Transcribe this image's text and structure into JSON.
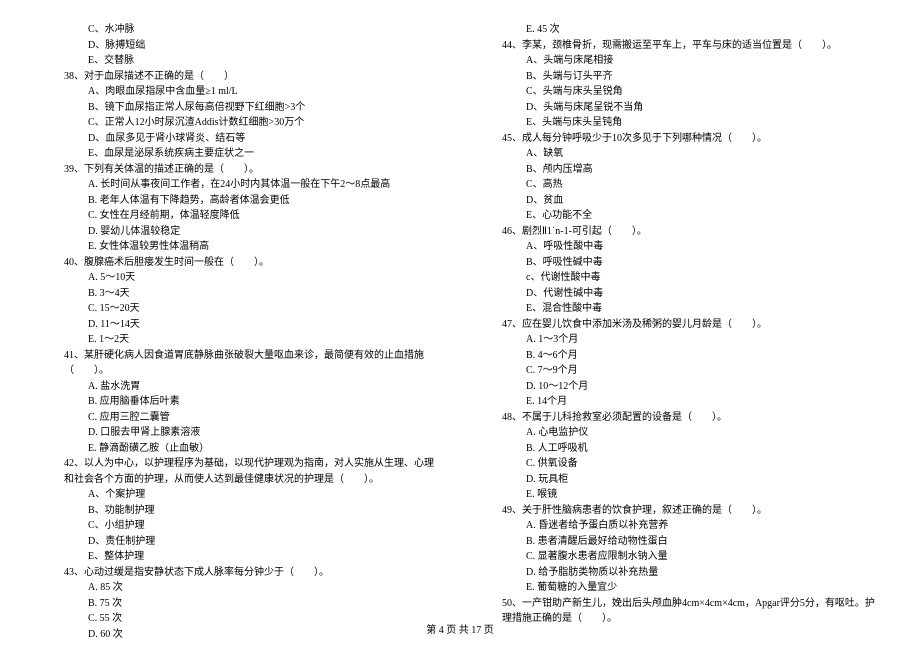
{
  "left": {
    "opts_pre38": [
      "C、水冲脉",
      "D、脉搏短绌",
      "E、交替脉"
    ],
    "q38": "38、对于血尿描述不正确的是（　　）",
    "q38_opts": [
      "A、肉眼血尿指尿中含血量≥1 ml/L",
      "B、镜下血尿指正常人尿每高倍视野下红细胞>3个",
      "C、正常人12小时尿沉渣Addis计数红细胞>30万个",
      "D、血尿多见于肾小球肾炎、结石等",
      "E、血尿是泌尿系统疾病主要症状之一"
    ],
    "q39": "39、下列有关体温的描述正确的是（　　）。",
    "q39_opts": [
      "A. 长时间从事夜间工作者，在24小时内其体温一般在下午2～8点最高",
      "B. 老年人体温有下降趋势，高龄者体温会更低",
      "C. 女性在月经前期，体温轻度降低",
      "D. 婴幼儿体温较稳定",
      "E. 女性体温较男性体温稍高"
    ],
    "q40": "40、腹腺癌术后胆瘘发生时间一般在（　　）。",
    "q40_opts": [
      "A. 5～10天",
      "B. 3～4天",
      "C. 15～20天",
      "D. 11～14天",
      "E. 1～2天"
    ],
    "q41": "41、某肝硬化病人因食道胃底静脉曲张破裂大量呕血来诊，最简便有效的止血措施（　　）。",
    "q41_opts": [
      "A. 盐水洗胃",
      "B. 应用脑垂体后叶素",
      "C. 应用三腔二囊管",
      "D. 口服去甲肾上腺素溶液",
      "E. 静滴酚磺乙胺（止血敏）"
    ],
    "q42": "42、以人为中心，以护理程序为基础，以现代护理观为指南，对人实施从生理、心理和社会各个方面的护理，从而使人达到最佳健康状况的护理是（　　）。",
    "q42_opts": [
      "A、个案护理",
      "B、功能制护理",
      "C、小组护理",
      "D、责任制护理",
      "E、整体护理"
    ],
    "q43": "43、心动过缓是指安静状态下成人脉率每分钟少于（　　）。",
    "q43_opts": [
      "A.  85 次",
      "B.  75 次",
      "C.  55 次",
      "D.  60 次"
    ]
  },
  "right": {
    "opts_pre44": [
      "E.  45 次"
    ],
    "q44": "44、李某，颈椎骨折，现需搬运至平车上，平车与床的适当位置是（　　）。",
    "q44_opts": [
      "A、头端与床尾相接",
      "B、头端与订头平齐",
      "C、头端与床头呈锐角",
      "D、头端与床尾呈锐不当角",
      "E、头端与床头呈钝角"
    ],
    "q45": "45、成人每分钟呼吸少于10次多见于下列哪种情况（　　）。",
    "q45_opts": [
      "A、缺氧",
      "B、颅内压增高",
      "C、高热",
      "D、贫血",
      "E、心功能不全"
    ],
    "q46": "46、剧烈Ⅱ1˙n-1-可引起（　　）。",
    "q46_opts": [
      "A、呼吸性酸中毒",
      "B、呼吸性碱中毒",
      "c、代谢性酸中毒",
      "D、代谢性碱中毒",
      "E、混合性酸中毒"
    ],
    "q47": "47、应在婴儿饮食中添加米汤及稀粥的婴儿月龄是（　　）。",
    "q47_opts": [
      "A. 1～3个月",
      "B. 4～6个月",
      "C. 7～9个月",
      "D. 10～12个月",
      "E. 14个月"
    ],
    "q48": "48、不属于儿科抢救室必须配置的设备是（　　）。",
    "q48_opts": [
      "A.  心电监护仪",
      "B.  人工呼吸机",
      "C.  供氧设备",
      "D.  玩具柜",
      "E.  喉镜"
    ],
    "q49": "49、关于肝性脑病患者的饮食护理，叙述正确的是（　　）。",
    "q49_opts": [
      "A. 昏迷者给予蛋白质以补充营养",
      "B. 患者清醒后最好给动物性蛋白",
      "C. 显著腹水患者应限制水钠入量",
      "D. 给予脂肪类物质以补充热量",
      "E. 葡萄糖的入量宜少"
    ],
    "q50": "50、一产钳助产新生儿，娩出后头颅血肿4cm×4cm×4cm，Apgar评分5分，有呕吐。护理措施正确的是（　　）。"
  },
  "footer": "第 4 页 共 17 页"
}
